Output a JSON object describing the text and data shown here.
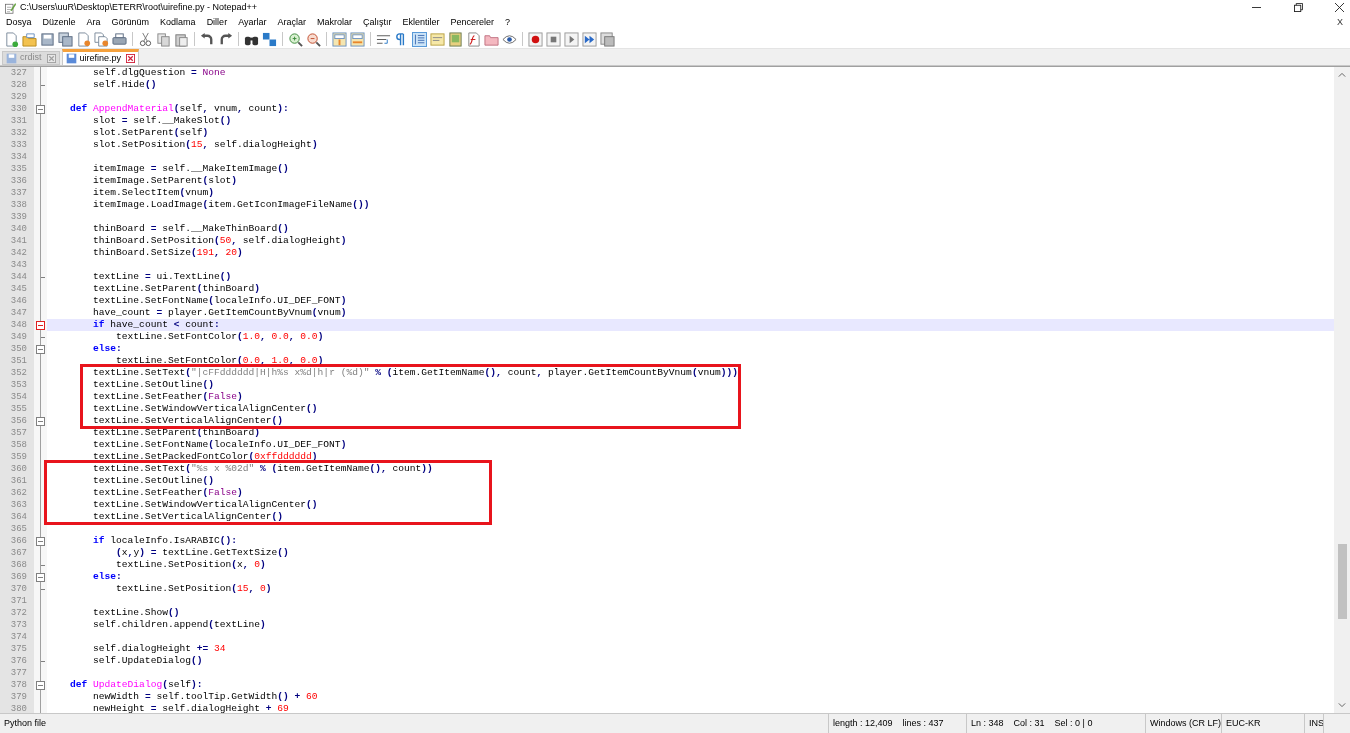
{
  "window": {
    "title": "C:\\Users\\uuR\\Desktop\\ETERR\\root\\uirefine.py - Notepad++"
  },
  "menu": [
    "Dosya",
    "Düzenle",
    "Ara",
    "Görünüm",
    "Kodlama",
    "Diller",
    "Ayarlar",
    "Araçlar",
    "Makrolar",
    "Çalıştır",
    "Eklentiler",
    "Pencereler",
    "?"
  ],
  "close_document": "X",
  "tabs": [
    {
      "label": "crdist",
      "selected": false
    },
    {
      "label": "uirefine.py",
      "selected": true
    }
  ],
  "lines": [
    {
      "number": "327",
      "kind": "plain",
      "current": false,
      "boxed": false,
      "segments": [
        {
          "kind": "plain",
          "text": "        self.dlgQuestion "
        },
        {
          "kind": "op",
          "text": "= "
        },
        {
          "kind": "builtin",
          "text": "None"
        }
      ]
    },
    {
      "number": "328",
      "kind": "fold-end",
      "current": false,
      "boxed": false,
      "segments": [
        {
          "kind": "plain",
          "text": "        self.Hide"
        },
        {
          "kind": "op",
          "text": "()"
        }
      ]
    },
    {
      "number": "329",
      "kind": "plain",
      "current": false,
      "boxed": false
    },
    {
      "number": "330",
      "kind": "fold-start",
      "current": false,
      "boxed": false,
      "segments": [
        {
          "kind": "keyword",
          "text": "    def "
        },
        {
          "kind": "defname",
          "text": "AppendMaterial"
        },
        {
          "kind": "op",
          "text": "("
        },
        {
          "kind": "plain",
          "text": "self"
        },
        {
          "kind": "op",
          "text": ","
        },
        {
          "kind": "plain",
          "text": " vnum"
        },
        {
          "kind": "op",
          "text": ","
        },
        {
          "kind": "plain",
          "text": " count"
        },
        {
          "kind": "op",
          "text": "):"
        }
      ]
    },
    {
      "number": "331",
      "kind": "plain",
      "current": false,
      "boxed": false,
      "segments": [
        {
          "kind": "plain",
          "text": "        slot "
        },
        {
          "kind": "op",
          "text": "="
        },
        {
          "kind": "plain",
          "text": " self.__MakeSlot"
        },
        {
          "kind": "op",
          "text": "()"
        }
      ]
    },
    {
      "number": "332",
      "kind": "plain",
      "current": false,
      "boxed": false,
      "segments": [
        {
          "kind": "plain",
          "text": "        slot.SetParent"
        },
        {
          "kind": "op",
          "text": "("
        },
        {
          "kind": "plain",
          "text": "self"
        },
        {
          "kind": "op",
          "text": ")"
        }
      ]
    },
    {
      "number": "333",
      "kind": "plain",
      "current": false,
      "boxed": false,
      "segments": [
        {
          "kind": "plain",
          "text": "        slot.SetPosition"
        },
        {
          "kind": "op",
          "text": "("
        },
        {
          "kind": "number",
          "text": "15"
        },
        {
          "kind": "op",
          "text": ","
        },
        {
          "kind": "plain",
          "text": " self.dialogHeight"
        },
        {
          "kind": "op",
          "text": ")"
        }
      ]
    },
    {
      "number": "334",
      "kind": "plain",
      "current": false,
      "boxed": false
    },
    {
      "number": "335",
      "kind": "plain",
      "current": false,
      "boxed": false,
      "segments": [
        {
          "kind": "plain",
          "text": "        itemImage "
        },
        {
          "kind": "op",
          "text": "="
        },
        {
          "kind": "plain",
          "text": " self.__MakeItemImage"
        },
        {
          "kind": "op",
          "text": "()"
        }
      ]
    },
    {
      "number": "336",
      "kind": "plain",
      "current": false,
      "boxed": false,
      "segments": [
        {
          "kind": "plain",
          "text": "        itemImage.SetParent"
        },
        {
          "kind": "op",
          "text": "("
        },
        {
          "kind": "plain",
          "text": "slot"
        },
        {
          "kind": "op",
          "text": ")"
        }
      ]
    },
    {
      "number": "337",
      "kind": "plain",
      "current": false,
      "boxed": false,
      "segments": [
        {
          "kind": "plain",
          "text": "        item.SelectItem"
        },
        {
          "kind": "op",
          "text": "("
        },
        {
          "kind": "plain",
          "text": "vnum"
        },
        {
          "kind": "op",
          "text": ")"
        }
      ]
    },
    {
      "number": "338",
      "kind": "plain",
      "current": false,
      "boxed": false,
      "segments": [
        {
          "kind": "plain",
          "text": "        itemImage.LoadImage"
        },
        {
          "kind": "op",
          "text": "("
        },
        {
          "kind": "plain",
          "text": "item.GetIconImageFileName"
        },
        {
          "kind": "op",
          "text": "())"
        }
      ]
    },
    {
      "number": "339",
      "kind": "plain",
      "current": false,
      "boxed": false
    },
    {
      "number": "340",
      "kind": "plain",
      "current": false,
      "boxed": false,
      "segments": [
        {
          "kind": "plain",
          "text": "        thinBoard "
        },
        {
          "kind": "op",
          "text": "="
        },
        {
          "kind": "plain",
          "text": " self.__MakeThinBoard"
        },
        {
          "kind": "op",
          "text": "()"
        }
      ]
    },
    {
      "number": "341",
      "kind": "plain",
      "current": false,
      "boxed": false,
      "segments": [
        {
          "kind": "plain",
          "text": "        thinBoard.SetPosition"
        },
        {
          "kind": "op",
          "text": "("
        },
        {
          "kind": "number",
          "text": "50"
        },
        {
          "kind": "op",
          "text": ","
        },
        {
          "kind": "plain",
          "text": " self.dialogHeight"
        },
        {
          "kind": "op",
          "text": ")"
        }
      ]
    },
    {
      "number": "342",
      "kind": "plain",
      "current": false,
      "boxed": false,
      "segments": [
        {
          "kind": "plain",
          "text": "        thinBoard.SetSize"
        },
        {
          "kind": "op",
          "text": "("
        },
        {
          "kind": "number",
          "text": "191"
        },
        {
          "kind": "op",
          "text": ", "
        },
        {
          "kind": "number",
          "text": "20"
        },
        {
          "kind": "op",
          "text": ")"
        }
      ]
    },
    {
      "number": "343",
      "kind": "plain",
      "current": false,
      "boxed": false
    },
    {
      "number": "344",
      "kind": "fold-end",
      "current": false,
      "boxed": false,
      "segments": [
        {
          "kind": "plain",
          "text": "        textLine "
        },
        {
          "kind": "op",
          "text": "="
        },
        {
          "kind": "plain",
          "text": " ui.TextLine"
        },
        {
          "kind": "op",
          "text": "()"
        }
      ]
    },
    {
      "number": "345",
      "kind": "plain",
      "current": false,
      "boxed": false,
      "segments": [
        {
          "kind": "plain",
          "text": "        textLine.SetParent"
        },
        {
          "kind": "op",
          "text": "("
        },
        {
          "kind": "plain",
          "text": "thinBoard"
        },
        {
          "kind": "op",
          "text": ")"
        }
      ]
    },
    {
      "number": "346",
      "kind": "plain",
      "current": false,
      "boxed": false,
      "segments": [
        {
          "kind": "plain",
          "text": "        textLine.SetFontName"
        },
        {
          "kind": "op",
          "text": "("
        },
        {
          "kind": "plain",
          "text": "localeInfo.UI_DEF_FONT"
        },
        {
          "kind": "op",
          "text": ")"
        }
      ]
    },
    {
      "number": "347",
      "kind": "plain",
      "current": false,
      "boxed": false,
      "segments": [
        {
          "kind": "plain",
          "text": "        have_count "
        },
        {
          "kind": "op",
          "text": "="
        },
        {
          "kind": "plain",
          "text": " player.GetItemCountByVnum"
        },
        {
          "kind": "op",
          "text": "("
        },
        {
          "kind": "plain",
          "text": "vnum"
        },
        {
          "kind": "op",
          "text": ")"
        }
      ]
    },
    {
      "number": "348",
      "kind": "fold-start",
      "current": true,
      "boxed": false,
      "segments": [
        {
          "kind": "keyword",
          "text": "        if"
        },
        {
          "kind": "plain",
          "text": " have_count "
        },
        {
          "kind": "op",
          "text": "<"
        },
        {
          "kind": "plain",
          "text": " count"
        },
        {
          "kind": "op",
          "text": ":"
        }
      ]
    },
    {
      "number": "349",
      "kind": "fold-end",
      "current": false,
      "boxed": false,
      "segments": [
        {
          "kind": "plain",
          "text": "            textLine.SetFontColor"
        },
        {
          "kind": "op",
          "text": "("
        },
        {
          "kind": "number",
          "text": "1.0"
        },
        {
          "kind": "op",
          "text": ", "
        },
        {
          "kind": "number",
          "text": "0.0"
        },
        {
          "kind": "op",
          "text": ", "
        },
        {
          "kind": "number",
          "text": "0.0"
        },
        {
          "kind": "op",
          "text": ")"
        }
      ]
    },
    {
      "number": "350",
      "kind": "fold-start",
      "current": false,
      "boxed": false,
      "segments": [
        {
          "kind": "keyword",
          "text": "        else"
        },
        {
          "kind": "op",
          "text": ":"
        }
      ]
    },
    {
      "number": "351",
      "kind": "plain",
      "current": false,
      "boxed": false,
      "segments": [
        {
          "kind": "plain",
          "text": "            textLine.SetFontColor"
        },
        {
          "kind": "op",
          "text": "("
        },
        {
          "kind": "number",
          "text": "0.0"
        },
        {
          "kind": "op",
          "text": ", "
        },
        {
          "kind": "number",
          "text": "1.0"
        },
        {
          "kind": "op",
          "text": ", "
        },
        {
          "kind": "number",
          "text": "0.0"
        },
        {
          "kind": "op",
          "text": ")"
        }
      ]
    },
    {
      "number": "352",
      "kind": "plain",
      "current": false,
      "boxed": true,
      "segments": [
        {
          "kind": "plain",
          "text": "        textLine.SetText"
        },
        {
          "kind": "op",
          "text": "("
        },
        {
          "kind": "string",
          "text": "\"|cFFdddddd|H|h%s x%d|h|r (%d)\" "
        },
        {
          "kind": "op",
          "text": "% ("
        },
        {
          "kind": "plain",
          "text": "item.GetItemName"
        },
        {
          "kind": "op",
          "text": "(),"
        },
        {
          "kind": "plain",
          "text": " count"
        },
        {
          "kind": "op",
          "text": ","
        },
        {
          "kind": "plain",
          "text": " player.GetItemCountByVnum"
        },
        {
          "kind": "op",
          "text": "("
        },
        {
          "kind": "plain",
          "text": "vnum"
        },
        {
          "kind": "op",
          "text": ")))"
        }
      ]
    },
    {
      "number": "353",
      "kind": "plain",
      "current": false,
      "boxed": true,
      "segments": [
        {
          "kind": "plain",
          "text": "        textLine.SetOutline"
        },
        {
          "kind": "op",
          "text": "()"
        }
      ]
    },
    {
      "number": "354",
      "kind": "plain",
      "current": false,
      "boxed": true,
      "segments": [
        {
          "kind": "plain",
          "text": "        textLine.SetFeather"
        },
        {
          "kind": "op",
          "text": "("
        },
        {
          "kind": "builtin",
          "text": "False"
        },
        {
          "kind": "op",
          "text": ")"
        }
      ]
    },
    {
      "number": "355",
      "kind": "plain",
      "current": false,
      "boxed": true,
      "segments": [
        {
          "kind": "plain",
          "text": "        textLine.SetWindowVerticalAlignCenter"
        },
        {
          "kind": "op",
          "text": "()"
        }
      ]
    },
    {
      "number": "356",
      "kind": "fold-start",
      "current": false,
      "boxed": true,
      "segments": [
        {
          "kind": "plain",
          "text": "        textLine.SetVerticalAlignCenter"
        },
        {
          "kind": "op",
          "text": "()"
        }
      ]
    },
    {
      "number": "357",
      "kind": "plain",
      "current": false,
      "boxed": false,
      "segments": [
        {
          "kind": "plain",
          "text": "        textLine.SetParent"
        },
        {
          "kind": "op",
          "text": "("
        },
        {
          "kind": "plain",
          "text": "thinBoard"
        },
        {
          "kind": "op",
          "text": ")"
        }
      ]
    },
    {
      "number": "358",
      "kind": "plain",
      "current": false,
      "boxed": false,
      "segments": [
        {
          "kind": "plain",
          "text": "        textLine.SetFontName"
        },
        {
          "kind": "op",
          "text": "("
        },
        {
          "kind": "plain",
          "text": "localeInfo.UI_DEF_FONT"
        },
        {
          "kind": "op",
          "text": ")"
        }
      ]
    },
    {
      "number": "359",
      "kind": "plain",
      "current": false,
      "boxed": false,
      "segments": [
        {
          "kind": "plain",
          "text": "        textLine.SetPackedFontColor"
        },
        {
          "kind": "op",
          "text": "("
        },
        {
          "kind": "number",
          "text": "0xffdddddd"
        },
        {
          "kind": "op",
          "text": ")"
        }
      ]
    },
    {
      "number": "360",
      "kind": "plain",
      "current": false,
      "boxed": true,
      "segments": [
        {
          "kind": "plain",
          "text": "        textLine.SetText"
        },
        {
          "kind": "op",
          "text": "("
        },
        {
          "kind": "string",
          "text": "\"%s x %02d\" "
        },
        {
          "kind": "op",
          "text": "% ("
        },
        {
          "kind": "plain",
          "text": "item.GetItemName"
        },
        {
          "kind": "op",
          "text": "(),"
        },
        {
          "kind": "plain",
          "text": " count"
        },
        {
          "kind": "op",
          "text": "))"
        }
      ]
    },
    {
      "number": "361",
      "kind": "plain",
      "current": false,
      "boxed": true,
      "segments": [
        {
          "kind": "plain",
          "text": "        textLine.SetOutline"
        },
        {
          "kind": "op",
          "text": "()"
        }
      ]
    },
    {
      "number": "362",
      "kind": "plain",
      "current": false,
      "boxed": true,
      "segments": [
        {
          "kind": "plain",
          "text": "        textLine.SetFeather"
        },
        {
          "kind": "op",
          "text": "("
        },
        {
          "kind": "builtin",
          "text": "False"
        },
        {
          "kind": "op",
          "text": ")"
        }
      ]
    },
    {
      "number": "363",
      "kind": "plain",
      "current": false,
      "boxed": true,
      "segments": [
        {
          "kind": "plain",
          "text": "        textLine.SetWindowVerticalAlignCenter"
        },
        {
          "kind": "op",
          "text": "()"
        }
      ]
    },
    {
      "number": "364",
      "kind": "plain",
      "current": false,
      "boxed": true,
      "segments": [
        {
          "kind": "plain",
          "text": "        textLine.SetVerticalAlignCenter"
        },
        {
          "kind": "op",
          "text": "()"
        }
      ]
    },
    {
      "number": "365",
      "kind": "plain",
      "current": false,
      "boxed": false
    },
    {
      "number": "366",
      "kind": "fold-start",
      "current": false,
      "boxed": false,
      "segments": [
        {
          "kind": "keyword",
          "text": "        if"
        },
        {
          "kind": "plain",
          "text": " localeInfo.IsARABIC"
        },
        {
          "kind": "op",
          "text": "():"
        }
      ]
    },
    {
      "number": "367",
      "kind": "plain",
      "current": false,
      "boxed": false,
      "segments": [
        {
          "kind": "op",
          "text": "            ("
        },
        {
          "kind": "plain",
          "text": "x"
        },
        {
          "kind": "op",
          "text": ","
        },
        {
          "kind": "plain",
          "text": "y"
        },
        {
          "kind": "op",
          "text": ") = "
        },
        {
          "kind": "plain",
          "text": "textLine.GetTextSize"
        },
        {
          "kind": "op",
          "text": "()"
        }
      ]
    },
    {
      "number": "368",
      "kind": "fold-end",
      "current": false,
      "boxed": false,
      "segments": [
        {
          "kind": "plain",
          "text": "            textLine.SetPosition"
        },
        {
          "kind": "op",
          "text": "("
        },
        {
          "kind": "plain",
          "text": "x"
        },
        {
          "kind": "op",
          "text": ", "
        },
        {
          "kind": "number",
          "text": "0"
        },
        {
          "kind": "op",
          "text": ")"
        }
      ]
    },
    {
      "number": "369",
      "kind": "fold-start",
      "current": false,
      "boxed": false,
      "segments": [
        {
          "kind": "keyword",
          "text": "        else"
        },
        {
          "kind": "op",
          "text": ":"
        }
      ]
    },
    {
      "number": "370",
      "kind": "fold-end",
      "current": false,
      "boxed": false,
      "segments": [
        {
          "kind": "plain",
          "text": "            textLine.SetPosition"
        },
        {
          "kind": "op",
          "text": "("
        },
        {
          "kind": "number",
          "text": "15"
        },
        {
          "kind": "op",
          "text": ", "
        },
        {
          "kind": "number",
          "text": "0"
        },
        {
          "kind": "op",
          "text": ")"
        }
      ]
    },
    {
      "number": "371",
      "kind": "plain",
      "current": false,
      "boxed": false
    },
    {
      "number": "372",
      "kind": "plain",
      "current": false,
      "boxed": false,
      "segments": [
        {
          "kind": "plain",
          "text": "        textLine.Show"
        },
        {
          "kind": "op",
          "text": "()"
        }
      ]
    },
    {
      "number": "373",
      "kind": "plain",
      "current": false,
      "boxed": false,
      "segments": [
        {
          "kind": "plain",
          "text": "        self.children.append"
        },
        {
          "kind": "op",
          "text": "("
        },
        {
          "kind": "plain",
          "text": "textLine"
        },
        {
          "kind": "op",
          "text": ")"
        }
      ]
    },
    {
      "number": "374",
      "kind": "plain",
      "current": false,
      "boxed": false
    },
    {
      "number": "375",
      "kind": "plain",
      "current": false,
      "boxed": false,
      "segments": [
        {
          "kind": "plain",
          "text": "        self.dialogHeight "
        },
        {
          "kind": "op",
          "text": "+= "
        },
        {
          "kind": "number",
          "text": "34"
        }
      ]
    },
    {
      "number": "376",
      "kind": "fold-end",
      "current": false,
      "boxed": false,
      "segments": [
        {
          "kind": "plain",
          "text": "        self.UpdateDialog"
        },
        {
          "kind": "op",
          "text": "()"
        }
      ]
    },
    {
      "number": "377",
      "kind": "plain",
      "current": false,
      "boxed": false
    },
    {
      "number": "378",
      "kind": "fold-start",
      "current": false,
      "boxed": false,
      "segments": [
        {
          "kind": "keyword",
          "text": "    def "
        },
        {
          "kind": "defname",
          "text": "UpdateDialog"
        },
        {
          "kind": "op",
          "text": "("
        },
        {
          "kind": "plain",
          "text": "self"
        },
        {
          "kind": "op",
          "text": "):"
        }
      ]
    },
    {
      "number": "379",
      "kind": "plain",
      "current": false,
      "boxed": false,
      "segments": [
        {
          "kind": "plain",
          "text": "        newWidth "
        },
        {
          "kind": "op",
          "text": "="
        },
        {
          "kind": "plain",
          "text": " self.toolTip.GetWidth"
        },
        {
          "kind": "op",
          "text": "() + "
        },
        {
          "kind": "number",
          "text": "60"
        }
      ]
    },
    {
      "number": "380",
      "kind": "plain",
      "current": false,
      "boxed": false,
      "segments": [
        {
          "kind": "plain",
          "text": "        newHeight "
        },
        {
          "kind": "op",
          "text": "="
        },
        {
          "kind": "plain",
          "text": " self.dialogHeight "
        },
        {
          "kind": "op",
          "text": "+ "
        },
        {
          "kind": "number",
          "text": "69"
        }
      ]
    }
  ],
  "status_bar": [
    {
      "items": [
        "Python file"
      ]
    },
    {
      "items": [
        "length : 12,409",
        "lines : 437"
      ]
    },
    {
      "items": [
        "Ln : 348",
        "Col : 31",
        "Sel : 0 | 0"
      ]
    },
    {
      "items": [
        "Windows (CR LF)"
      ]
    },
    {
      "items": [
        "EUC-KR"
      ]
    },
    {
      "items": [
        "INS"
      ]
    }
  ]
}
